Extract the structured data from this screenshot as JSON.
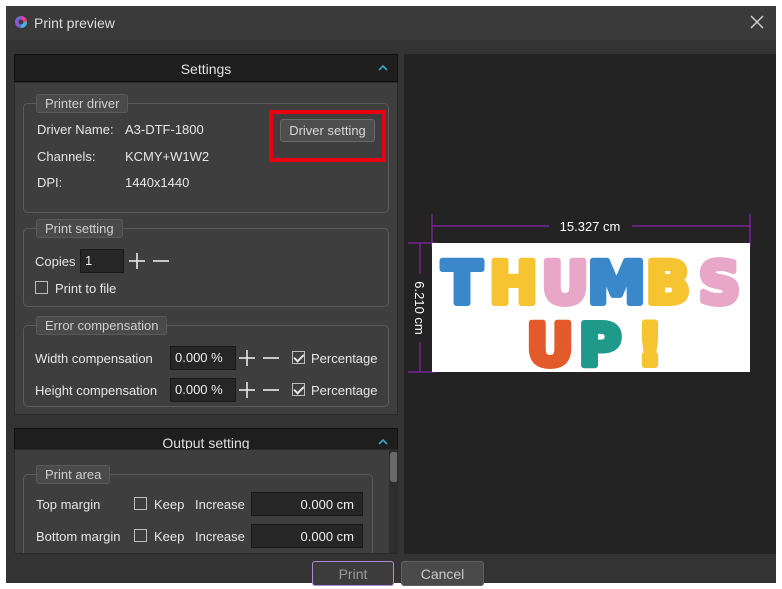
{
  "window": {
    "title": "Print preview"
  },
  "settings": {
    "header": "Settings",
    "printer_driver": {
      "title": "Printer driver",
      "driver_name_label": "Driver Name:",
      "driver_name_value": "A3-DTF-1800",
      "channels_label": "Channels:",
      "channels_value": "KCMY+W1W2",
      "dpi_label": "DPI:",
      "dpi_value": "1440x1440",
      "driver_setting_button": "Driver setting"
    },
    "print_setting": {
      "title": "Print setting",
      "copies_label": "Copies",
      "copies_value": "1",
      "print_to_file_label": "Print to file",
      "print_to_file_checked": false
    },
    "error_compensation": {
      "title": "Error compensation",
      "width_label": "Width compensation",
      "width_value": "0.000 %",
      "height_label": "Height compensation",
      "height_value": "0.000 %",
      "percentage_label": "Percentage",
      "width_percentage_checked": true,
      "height_percentage_checked": true
    }
  },
  "output": {
    "header": "Output setting",
    "print_area": {
      "title": "Print area",
      "top_margin_label": "Top margin",
      "bottom_margin_label": "Bottom margin",
      "keep_label": "Keep",
      "increase_label": "Increase",
      "top_margin_value": "0.000 cm",
      "bottom_margin_value": "0.000 cm"
    }
  },
  "preview": {
    "width_dim": "15.327 cm",
    "height_dim": "6.210 cm",
    "image_text_line1": "THUMBS",
    "image_text_line2": "UP!",
    "line1_colors": [
      "#3a87c9",
      "#f6c431",
      "#e8a6c8",
      "#3a87c9",
      "#f6c431",
      "#e8a6c8"
    ],
    "line2_colors": [
      "#e35b2a",
      "#1f9a8a",
      "#f6c431"
    ],
    "dimension_color": "#a020c8"
  },
  "buttons": {
    "print": "Print",
    "cancel": "Cancel"
  },
  "colors": {
    "highlight": "#e60012",
    "window_bg": "#333333",
    "preview_bg": "#232323"
  }
}
